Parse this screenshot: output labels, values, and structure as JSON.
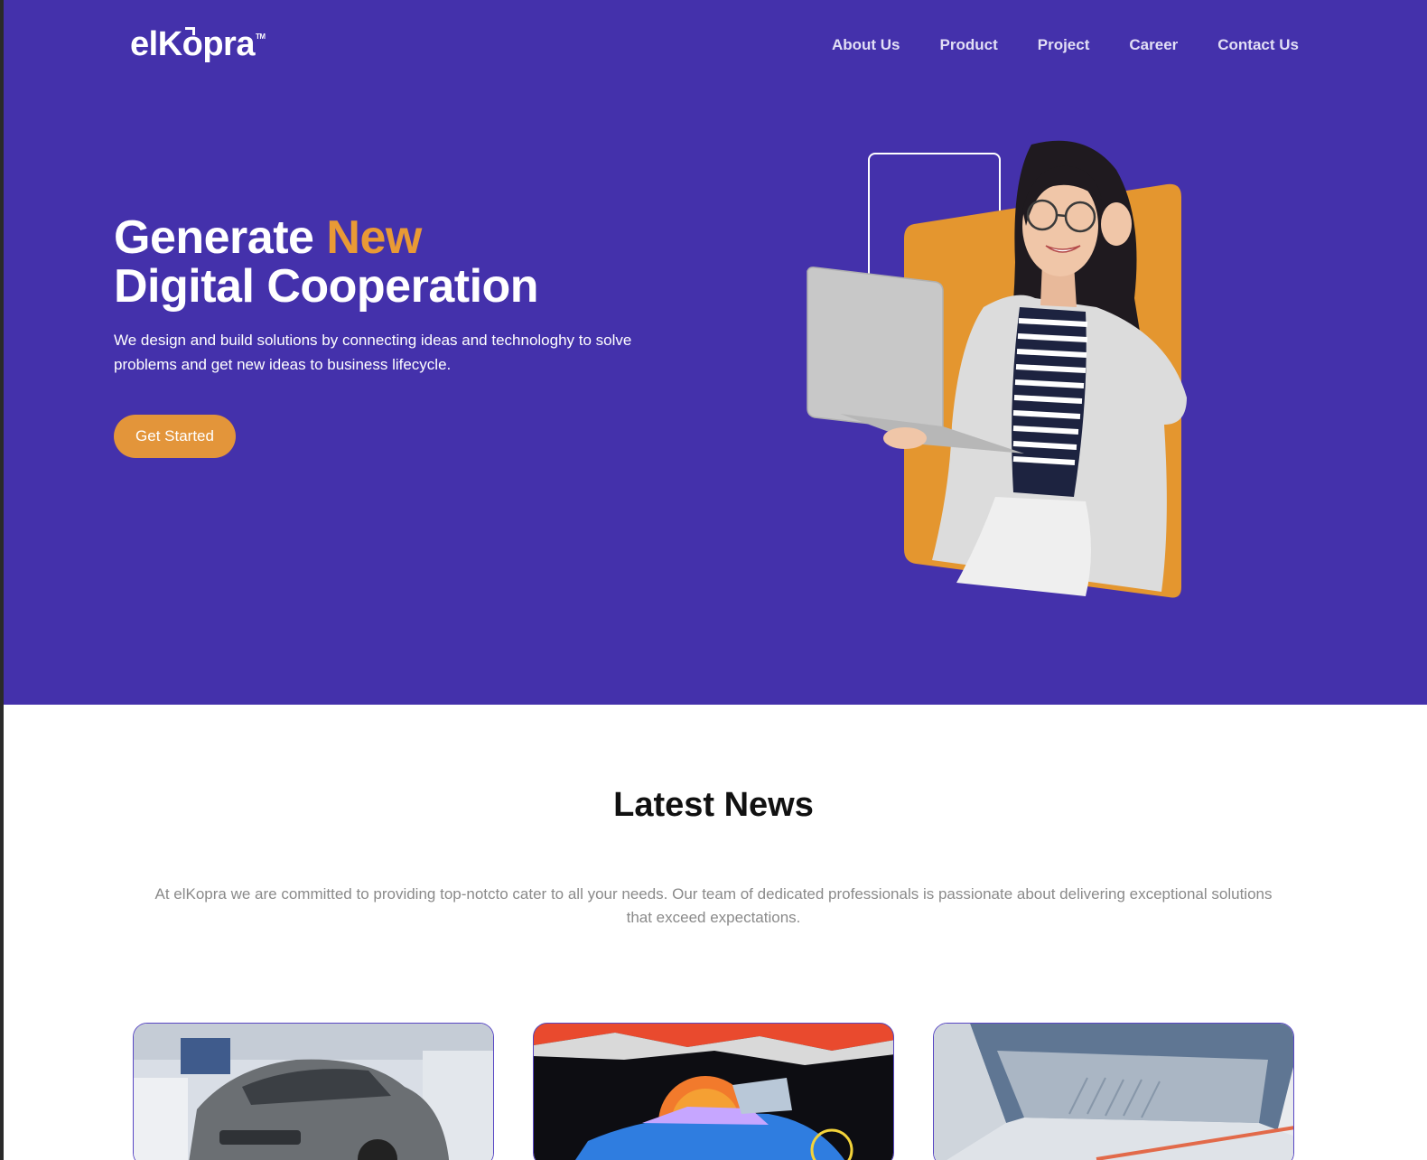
{
  "brand": {
    "logo_text": "elKopra",
    "logo_tm": "TM"
  },
  "nav": {
    "items": [
      {
        "label": "About Us"
      },
      {
        "label": "Product"
      },
      {
        "label": "Project"
      },
      {
        "label": "Career"
      },
      {
        "label": "Contact Us"
      }
    ]
  },
  "hero": {
    "headline_part1": "Generate ",
    "headline_accent": "New",
    "headline_line2": "Digital Cooperation",
    "description": "We design and build solutions by connecting ideas and technologhy to solve problems and get new ideas to business lifecycle.",
    "cta_label": "Get Started"
  },
  "news": {
    "title": "Latest News",
    "description": "At elKopra we are committed to providing top-notcto cater to all your needs. Our team of dedicated professionals is passionate about delivering exceptional solutions that exceed expectations."
  },
  "colors": {
    "hero_bg": "#4431ab",
    "accent": "#e3953a",
    "card_border": "#5847c4"
  }
}
